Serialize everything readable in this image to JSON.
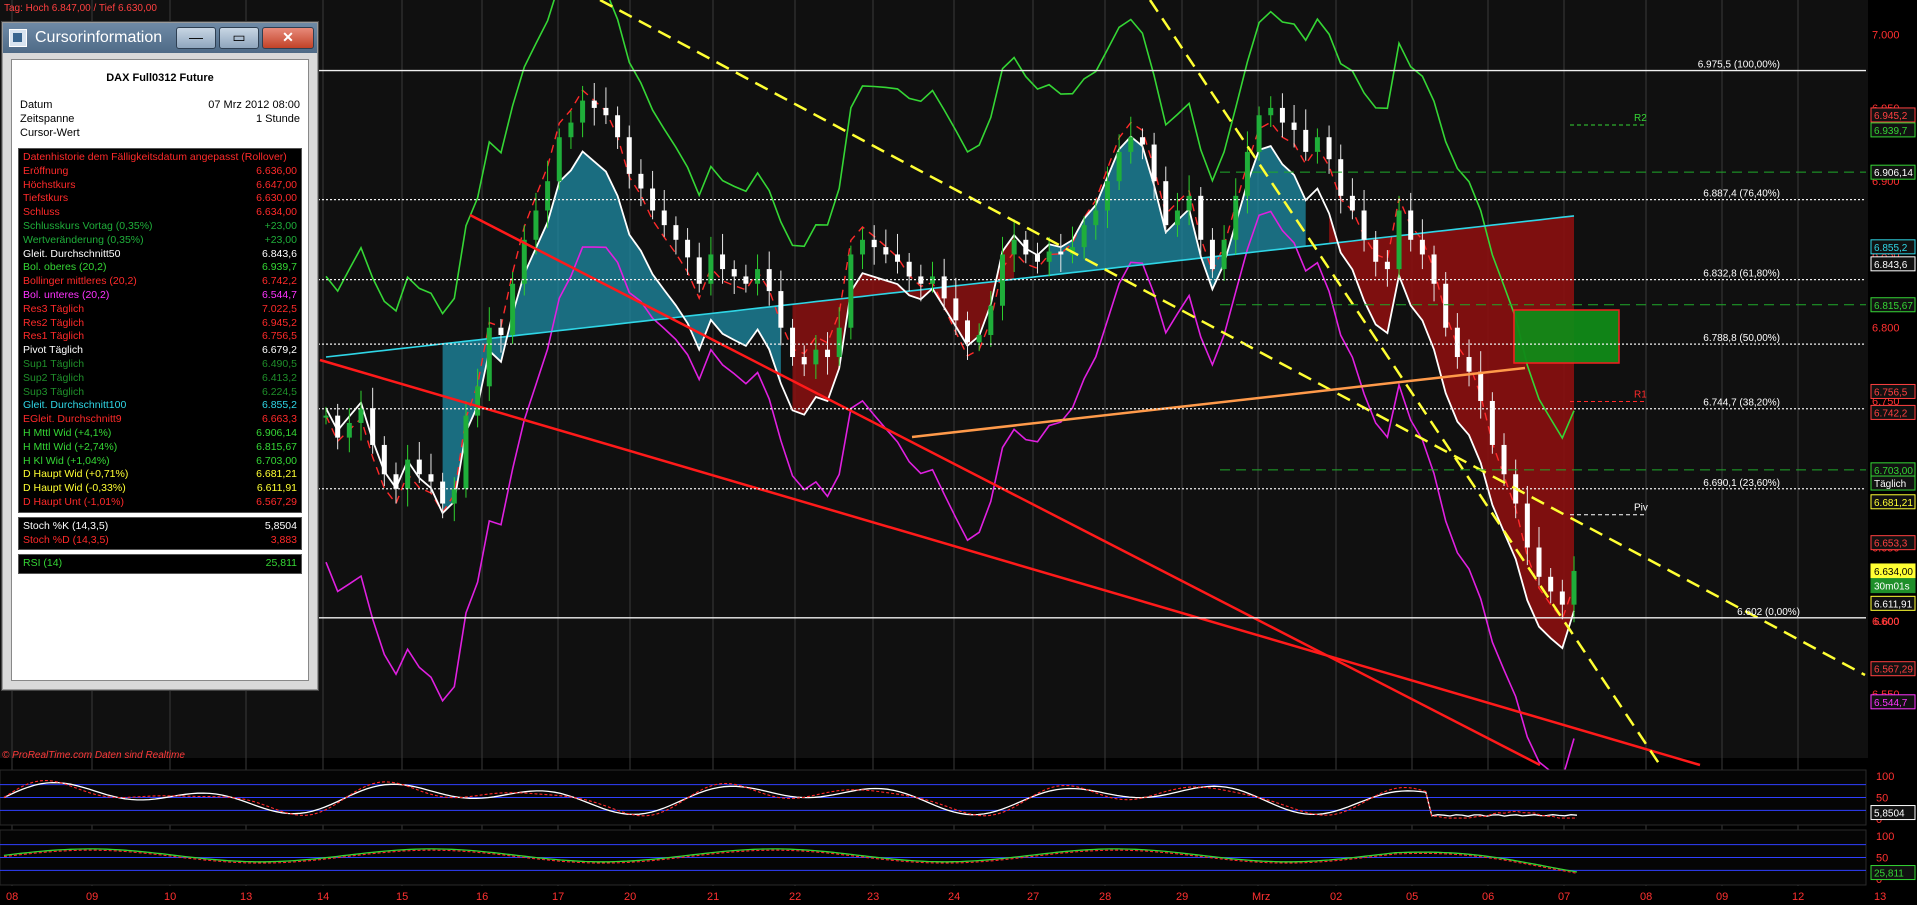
{
  "window": {
    "title": "Cursorinformation",
    "minimize_label": "—",
    "maximize_label": "▭",
    "close_label": "✕"
  },
  "top_status": "Tag: Hoch 6.847,00 / Tief 6.630,00",
  "cursor_info": {
    "instrument": "DAX Full0312 Future",
    "rows": [
      {
        "label": "Datum",
        "value": "07 Mrz 2012 08:00"
      },
      {
        "label": "Zeitspanne",
        "value": "1 Stunde"
      },
      {
        "label": "Cursor-Wert",
        "value": ""
      }
    ],
    "history_title": "Datenhistorie dem Fälligkeitsdatum angepasst (Rollover)",
    "history": [
      {
        "label": "Eröffnung",
        "value": "6.636,00",
        "color": "#ff2a2a"
      },
      {
        "label": "Höchstkurs",
        "value": "6.647,00",
        "color": "#ff2a2a"
      },
      {
        "label": "Tiefstkurs",
        "value": "6.630,00",
        "color": "#ff2a2a"
      },
      {
        "label": "Schluss",
        "value": "6.634,00",
        "color": "#ff2a2a"
      },
      {
        "label": "Schlusskurs Vortag (0,35%)",
        "value": "+23,00",
        "color": "#1fae3a"
      },
      {
        "label": "Wertveränderung (0,35%)",
        "value": "+23,00",
        "color": "#1fae3a"
      },
      {
        "label": "Gleit. Durchschnitt50",
        "value": "6.843,6",
        "color": "#ffffff"
      },
      {
        "label": "Bol. oberes (20,2)",
        "value": "6.939,7",
        "color": "#35d635"
      },
      {
        "label": "Bollinger mittleres (20,2)",
        "value": "6.742,2",
        "color": "#ff2a2a"
      },
      {
        "label": "Bol. unteres (20,2)",
        "value": "6.544,7",
        "color": "#ff34ff"
      },
      {
        "label": "Res3 Täglich",
        "value": "7.022,5",
        "color": "#ff2a2a"
      },
      {
        "label": "Res2 Täglich",
        "value": "6.945,2",
        "color": "#ff2a2a"
      },
      {
        "label": "Res1 Täglich",
        "value": "6.756,5",
        "color": "#ff2a2a"
      },
      {
        "label": "Pivot Täglich",
        "value": "6.679,2",
        "color": "#ffffff"
      },
      {
        "label": "Sup1 Täglich",
        "value": "6.490,5",
        "color": "#1f8f2a"
      },
      {
        "label": "Sup2 Täglich",
        "value": "6.413,2",
        "color": "#1f8f2a"
      },
      {
        "label": "Sup3 Täglich",
        "value": "6.224,5",
        "color": "#1f8f2a"
      },
      {
        "label": "Gleit. Durchschnitt100",
        "value": "6.855,2",
        "color": "#2fd6e6"
      },
      {
        "label": "EGleit. Durchschnitt9",
        "value": "6.663,3",
        "color": "#ff2a2a"
      },
      {
        "label": "H Mttl Wid (+4,1%)",
        "value": "6.906,14",
        "color": "#35d635"
      },
      {
        "label": "H Mttl Wid (+2,74%)",
        "value": "6.815,67",
        "color": "#35d635"
      },
      {
        "label": "H Kl Wid (+1,04%)",
        "value": "6.703,00",
        "color": "#35d635"
      },
      {
        "label": "D Haupt Wid (+0,71%)",
        "value": "6.681,21",
        "color": "#ffff33"
      },
      {
        "label": "D Haupt Wid (-0,33%)",
        "value": "6.611,91",
        "color": "#ffff33"
      },
      {
        "label": "D Haupt Unt (-1,01%)",
        "value": "6.567,29",
        "color": "#ff2a2a"
      }
    ],
    "stoch": [
      {
        "label": "Stoch %K (14,3,5)",
        "value": "5,8504",
        "color": "#ffffff"
      },
      {
        "label": "Stoch %D (14,3,5)",
        "value": "3,883",
        "color": "#ff2a2a"
      }
    ],
    "rsi": {
      "label": "RSI (14)",
      "value": "25,811",
      "color": "#35d635"
    }
  },
  "footer_note": "© ProRealTime.com   Daten sind Realtime",
  "chart_data": [
    {
      "type": "candlestick",
      "title": "DAX Full0312 Future",
      "ylim": [
        6520,
        7010
      ],
      "x_ticks": [
        "08",
        "09",
        "10",
        "13",
        "14",
        "15",
        "16",
        "17",
        "20",
        "21",
        "22",
        "23",
        "24",
        "27",
        "28",
        "29",
        "Mrz",
        "02",
        "05",
        "06",
        "07",
        "08",
        "09",
        "12",
        "13"
      ],
      "y_ticks": [
        "7.000",
        "6.950",
        "6.900",
        "6.850",
        "6.800",
        "6.750",
        "6.700",
        "6.650",
        "6.600",
        "6.550"
      ],
      "close_series": [
        6740,
        6725,
        6735,
        6745,
        6720,
        6700,
        6690,
        6710,
        6700,
        6695,
        6680,
        6690,
        6740,
        6760,
        6800,
        6795,
        6830,
        6860,
        6880,
        6900,
        6930,
        6940,
        6955,
        6950,
        6945,
        6930,
        6905,
        6895,
        6880,
        6870,
        6860,
        6848,
        6830,
        6850,
        6840,
        6835,
        6830,
        6840,
        6825,
        6800,
        6780,
        6775,
        6785,
        6780,
        6800,
        6850,
        6860,
        6855,
        6850,
        6845,
        6835,
        6830,
        6835,
        6820,
        6805,
        6790,
        6795,
        6815,
        6850,
        6860,
        6850,
        6845,
        6852,
        6850,
        6855,
        6870,
        6880,
        6900,
        6920,
        6930,
        6925,
        6900,
        6870,
        6880,
        6890,
        6860,
        6840,
        6860,
        6890,
        6920,
        6945,
        6950,
        6940,
        6935,
        6920,
        6930,
        6915,
        6890,
        6880,
        6860,
        6845,
        6840,
        6880,
        6860,
        6850,
        6830,
        6800,
        6780,
        6770,
        6750,
        6720,
        6700,
        6680,
        6650,
        6630,
        6620,
        6611,
        6634
      ],
      "fib_levels": [
        {
          "label": "6.975,5 (100,00%)",
          "value": 6975.5
        },
        {
          "label": "6.887,4 (76,40%)",
          "value": 6887.4
        },
        {
          "label": "6.832,8 (61,80%)",
          "value": 6832.8
        },
        {
          "label": "6.788,8 (50,00%)",
          "value": 6788.8
        },
        {
          "label": "6.744,7 (38,20%)",
          "value": 6744.7
        },
        {
          "label": "6.690,1 (23,60%)",
          "value": 6690.1
        },
        {
          "label": "6.602 (0,00%)",
          "value": 6602
        }
      ],
      "pivot_labels": [
        {
          "label": "R2",
          "value": 6945.2,
          "color": "#35d635"
        },
        {
          "label": "R1",
          "value": 6756.5,
          "color": "#ff2a2a"
        },
        {
          "label": "Piv",
          "value": 6679.2,
          "color": "#ffffff"
        }
      ],
      "right_tags": [
        {
          "label": "6.945,2",
          "value": 6945.2,
          "bg": "#111",
          "fg": "#ff4040",
          "border": "#ff4040"
        },
        {
          "label": "6.939,7",
          "value": 6935,
          "bg": "#111",
          "fg": "#35d635",
          "border": "#35d635"
        },
        {
          "label": "6.906,14",
          "value": 6906.14,
          "bg": "#111",
          "fg": "#ffffff",
          "border": "#35d635"
        },
        {
          "label": "6.855,2",
          "value": 6855.2,
          "bg": "#111",
          "fg": "#2fd6e6",
          "border": "#2fd6e6"
        },
        {
          "label": "6.843,6",
          "value": 6843.6,
          "bg": "#111",
          "fg": "#ffffff",
          "border": "#ffffff"
        },
        {
          "label": "6.815,67",
          "value": 6815.67,
          "bg": "#111",
          "fg": "#35d635",
          "border": "#35d635"
        },
        {
          "label": "6.756,5",
          "value": 6756.5,
          "bg": "#111",
          "fg": "#ff4040",
          "border": "#ff4040"
        },
        {
          "label": "6.742,2",
          "value": 6742.2,
          "bg": "#111",
          "fg": "#ff4040",
          "border": "#ff4040"
        },
        {
          "label": "6.703,00",
          "value": 6703,
          "bg": "#111",
          "fg": "#35d635",
          "border": "#35d635"
        },
        {
          "label": "Täglich",
          "value": 6694,
          "bg": "#111",
          "fg": "#ffffff",
          "border": "#35d635"
        },
        {
          "label": "6.681,21",
          "value": 6681.21,
          "bg": "#111",
          "fg": "#ffff33",
          "border": "#ffff33"
        },
        {
          "label": "6.653,3",
          "value": 6653.3,
          "bg": "#111",
          "fg": "#ff4040",
          "border": "#ff4040"
        },
        {
          "label": "6.634,00",
          "value": 6634,
          "bg": "#ffff33",
          "fg": "#000000",
          "border": "#ffff33"
        },
        {
          "label": "30m01s",
          "value": 6624,
          "bg": "#1f8f2a",
          "fg": "#ffffff",
          "border": "#1f8f2a"
        },
        {
          "label": "6.611,91",
          "value": 6611.91,
          "bg": "#111",
          "fg": "#ffffff",
          "border": "#ffff33"
        },
        {
          "label": "6.600",
          "value": 6600,
          "bg": "none",
          "fg": "#ff4040",
          "border": "none"
        },
        {
          "label": "6.567,29",
          "value": 6567.29,
          "bg": "#111",
          "fg": "#ff4040",
          "border": "#ff4040"
        },
        {
          "label": "6.544,7",
          "value": 6544.7,
          "bg": "#111",
          "fg": "#ff34ff",
          "border": "#ff34ff"
        }
      ]
    },
    {
      "type": "line",
      "title": "Stoch %K (14,3,5)",
      "ylim": [
        0,
        100
      ],
      "y_ticks": [
        "100",
        "50",
        "0"
      ],
      "last_value": "5,8504"
    },
    {
      "type": "line",
      "title": "RSI (14)",
      "ylim": [
        0,
        100
      ],
      "y_ticks": [
        "100",
        "50",
        "0"
      ],
      "last_value": "25,811"
    }
  ]
}
